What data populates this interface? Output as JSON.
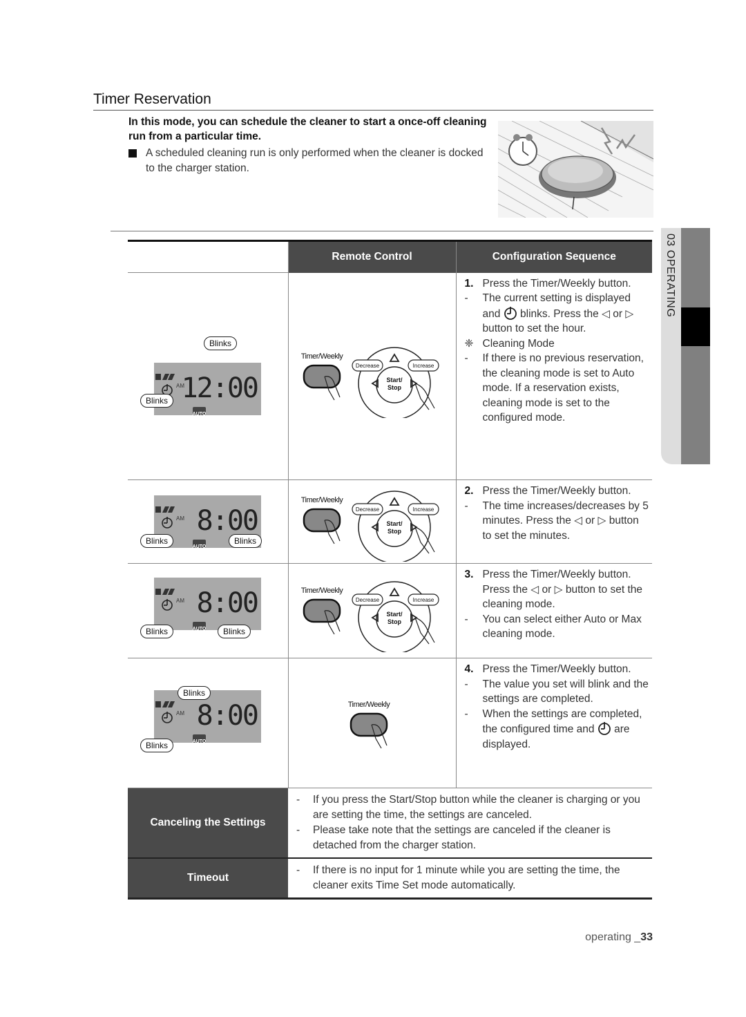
{
  "page": {
    "title": "Timer Reservation",
    "intro": "In this mode, you can schedule the cleaner to start a once-off cleaning run from a particular time.",
    "note": "A scheduled cleaning run is only performed when the cleaner is docked to the charger station.",
    "side_tab": "03  OPERATING",
    "footer": {
      "section": "operating _",
      "number": "33"
    }
  },
  "table": {
    "headers": [
      "",
      "Remote Control",
      "Configuration Sequence"
    ],
    "rows": [
      {
        "lcd": {
          "time": "12:00",
          "ampm": "AM",
          "mode": "AUTO",
          "blinks": [
            "Blinks",
            "Blinks"
          ]
        },
        "remote": {
          "timer_label": "Timer/Weekly",
          "decrease": "Decrease",
          "increase": "Increase",
          "start": "Start/",
          "stop": "Stop"
        },
        "steps": [
          {
            "num": "1.",
            "text": "Press the Timer/Weekly button."
          },
          {
            "dash": "-",
            "text_a": "The current setting is displayed and",
            "text_b": "blinks. Press the ◁ or ▷ button to set the hour."
          },
          {
            "icon": "❈",
            "text": "Cleaning Mode"
          },
          {
            "dash": "-",
            "text": "If there is no previous reservation, the cleaning mode is set to Auto mode. If a reservation exists, cleaning mode is set to the configured mode."
          }
        ]
      },
      {
        "lcd": {
          "time": "8:00",
          "ampm": "AM",
          "mode": "AUTO",
          "blinks": [
            "Blinks",
            "Blinks"
          ]
        },
        "remote": {
          "timer_label": "Timer/Weekly",
          "decrease": "Decrease",
          "increase": "Increase",
          "start": "Start/",
          "stop": "Stop"
        },
        "steps": [
          {
            "num": "2.",
            "text": "Press the Timer/Weekly button."
          },
          {
            "dash": "-",
            "text": "The time increases/decreases by 5 minutes. Press the ◁ or ▷ button to set the minutes."
          }
        ]
      },
      {
        "lcd": {
          "time": "8:00",
          "ampm": "AM",
          "mode": "AUTO",
          "blinks": [
            "Blinks",
            "Blinks"
          ]
        },
        "remote": {
          "timer_label": "Timer/Weekly",
          "decrease": "Decrease",
          "increase": "Increase",
          "start": "Start/",
          "stop": "Stop"
        },
        "steps": [
          {
            "num": "3.",
            "text": "Press the Timer/Weekly button. Press the ◁ or ▷ button to set the cleaning mode."
          },
          {
            "dash": "-",
            "text": "You can select either Auto or Max cleaning mode."
          }
        ]
      },
      {
        "lcd": {
          "time": "8:00",
          "ampm": "AM",
          "mode": "AUTO",
          "blinks": [
            "Blinks",
            "Blinks"
          ]
        },
        "remote": {
          "timer_label": "Timer/Weekly"
        },
        "steps": [
          {
            "num": "4.",
            "text": "Press the Timer/Weekly button."
          },
          {
            "dash": "-",
            "text": "The value you set will blink and the settings are completed."
          },
          {
            "dash": "-",
            "text_a": "When the settings are completed, the configured time and",
            "text_b": "are displayed."
          }
        ]
      }
    ],
    "footer_rows": [
      {
        "label": "Canceling the Settings",
        "items": [
          "If you press the Start/Stop button while the cleaner is charging or you are setting the time, the settings are canceled.",
          "Please take note that the settings are canceled if the cleaner is detached from the charger station."
        ]
      },
      {
        "label": "Timeout",
        "items": [
          "If there is no input for 1 minute while you are setting the time, the cleaner exits Time Set mode automatically."
        ]
      }
    ]
  }
}
